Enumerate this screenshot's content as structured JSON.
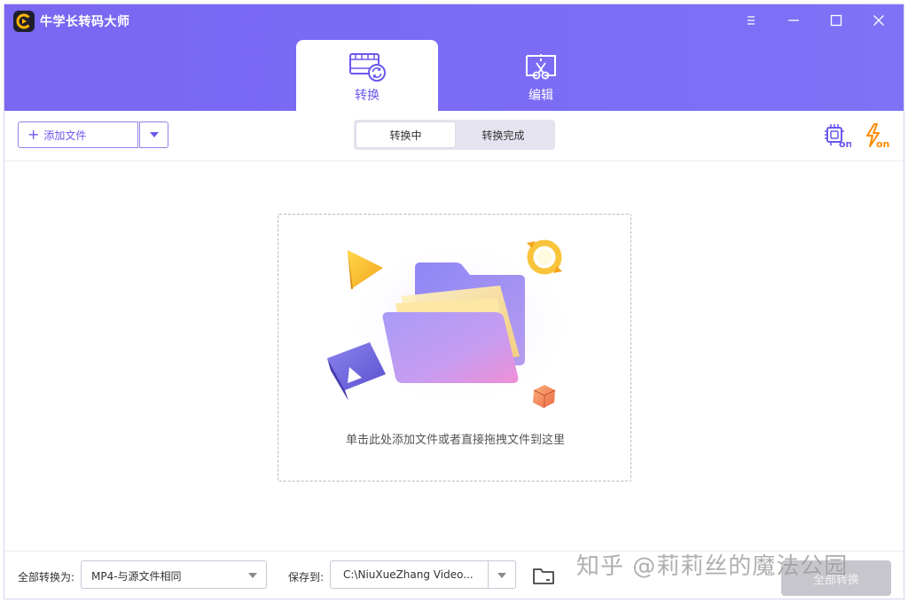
{
  "app": {
    "title": "牛学长转码大师",
    "accent_color": "#7a67f2"
  },
  "window_controls": {
    "menu_icon": "menu-icon",
    "minimize_icon": "minimize-icon",
    "maximize_icon": "maximize-icon",
    "close_icon": "close-icon"
  },
  "tabs": [
    {
      "label": "转换",
      "icon": "convert-film-icon",
      "active": true
    },
    {
      "label": "编辑",
      "icon": "edit-cut-icon",
      "active": false
    }
  ],
  "toolbar": {
    "add_file_label": "添加文件",
    "segments": [
      "转换中",
      "转换完成"
    ],
    "gpu_icon": "gpu-acceleration-on-icon",
    "gpu_badge": "on",
    "speed_icon": "high-speed-on-icon",
    "speed_badge": "on"
  },
  "dropzone": {
    "hint": "单击此处添加文件或者直接拖拽文件到这里"
  },
  "footer": {
    "convert_all_label": "全部转换为:",
    "format_value": "MP4-与源文件相同",
    "save_to_label": "保存到:",
    "path_value": "C:\\NiuXueZhang Video...",
    "start_label": "全部转换"
  },
  "watermark": "知乎 @莉莉丝的魔法公园"
}
